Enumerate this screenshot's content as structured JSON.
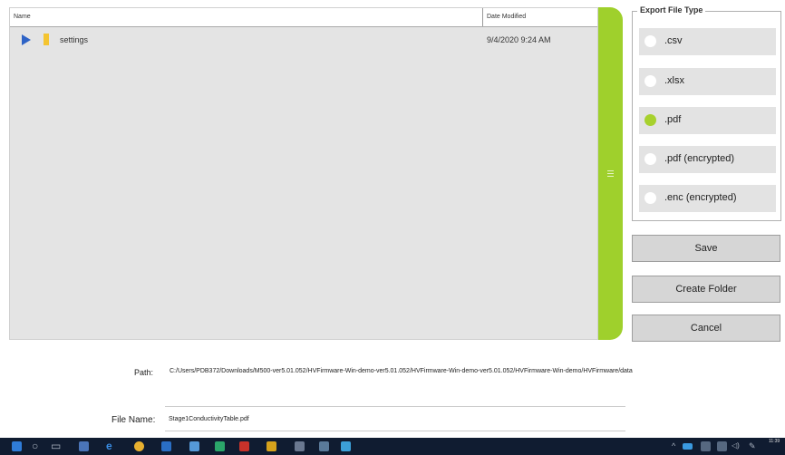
{
  "file_list": {
    "columns": {
      "name": "Name",
      "date_modified": "Date Modified"
    },
    "rows": [
      {
        "name": "settings",
        "date": "9/4/2020 9:24 AM",
        "type_icon": "folder-icon"
      }
    ]
  },
  "export": {
    "legend": "Export File Type",
    "options": [
      {
        "label": ".csv",
        "selected": false
      },
      {
        "label": ".xlsx",
        "selected": false
      },
      {
        "label": ".pdf",
        "selected": true
      },
      {
        "label": ".pdf (encrypted)",
        "selected": false
      },
      {
        "label": ".enc (encrypted)",
        "selected": false
      }
    ]
  },
  "buttons": {
    "save": "Save",
    "create_folder": "Create Folder",
    "cancel": "Cancel"
  },
  "path": {
    "label": "Path:",
    "value": "C:/Users/PDB372/Downloads/M500-ver5.01.052/HVFirmware-Win-demo-ver5.01.052/HVFirmware-Win-demo-ver5.01.052/HVFirmware-Win-demo/HVFirmware/data"
  },
  "file_name": {
    "label": "File Name:",
    "value": "Stage1ConductivityTable.pdf"
  },
  "taskbar": {
    "time": "11:39"
  },
  "colors": {
    "accent": "#9fd02c",
    "selected_radio": "#a7d12d",
    "taskbar": "#101c31",
    "panel": "#e4e4e4"
  }
}
